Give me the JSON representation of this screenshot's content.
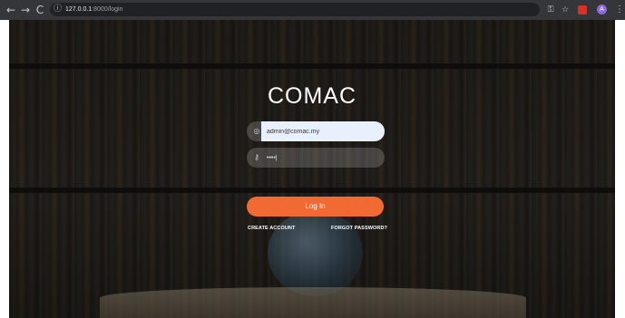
{
  "browser": {
    "url_host": "127.0.0.1",
    "url_rest": ":8000/login"
  },
  "page": {
    "title": "COMAC",
    "email_value": "admin@comac.my",
    "password_value": "••••|",
    "login_label": "Log In",
    "create_account_label": "CREATE ACCOUNT",
    "forgot_password_label": "FORGOT PASSWORD?"
  },
  "icons": {
    "back": "back-arrow-icon",
    "forward": "forward-arrow-icon",
    "reload": "reload-icon",
    "info": "info-icon",
    "key": "key-icon",
    "star": "star-icon",
    "extension": "extension-icon",
    "profile": "profile-avatar",
    "menu": "kebab-menu-icon",
    "email_field": "at-sign-icon",
    "password_field": "key-icon"
  },
  "colors": {
    "accent": "#f26a33",
    "autofill": "#e8f0fe",
    "chrome_bar": "#35363a"
  }
}
